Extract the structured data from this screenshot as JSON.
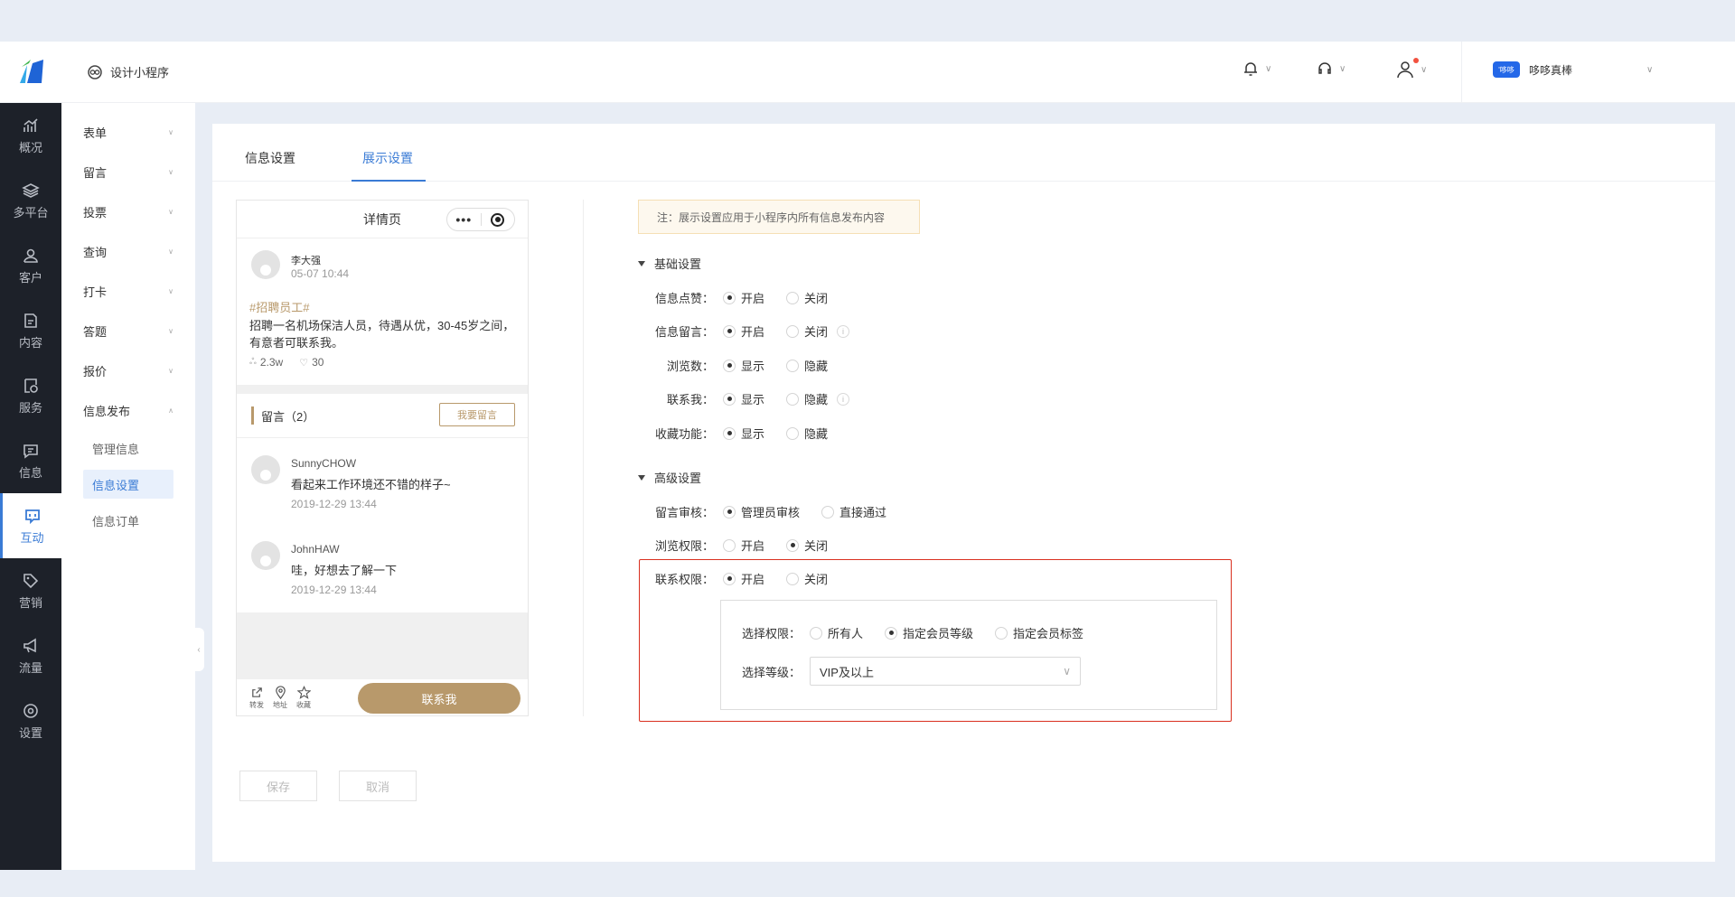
{
  "header": {
    "crumb": "设计小程序",
    "user_name": "哆哆真棒",
    "user_badge": "'哆哆"
  },
  "dark_nav": [
    {
      "label": "概况",
      "icon": "chart-icon"
    },
    {
      "label": "多平台",
      "icon": "layers-icon"
    },
    {
      "label": "客户",
      "icon": "user-icon"
    },
    {
      "label": "内容",
      "icon": "document-icon"
    },
    {
      "label": "服务",
      "icon": "service-icon"
    },
    {
      "label": "信息",
      "icon": "message-icon"
    },
    {
      "label": "互动",
      "icon": "interact-icon"
    },
    {
      "label": "营销",
      "icon": "tag-icon"
    },
    {
      "label": "流量",
      "icon": "megaphone-icon"
    },
    {
      "label": "设置",
      "icon": "settings-icon"
    }
  ],
  "sub_nav": {
    "items": [
      "表单",
      "留言",
      "投票",
      "查询",
      "打卡",
      "答题",
      "报价",
      "信息发布"
    ],
    "children": [
      "管理信息",
      "信息设置",
      "信息订单"
    ]
  },
  "tabs": [
    "信息设置",
    "展示设置"
  ],
  "phone": {
    "title": "详情页",
    "post": {
      "name": "李大强",
      "time": "05-07 10:44",
      "tag": "#招聘员工#",
      "text": "招聘一名机场保洁人员，待遇从优，30-45岁之间，有意者可联系我。",
      "views": "2.3w",
      "likes": "30"
    },
    "comments_title": "留言（2）",
    "comment_button": "我要留言",
    "comments": [
      {
        "name": "SunnyCHOW",
        "text": "看起来工作环境还不错的样子~",
        "time": "2019-12-29 13:44"
      },
      {
        "name": "JohnHAW",
        "text": "哇，好想去了解一下",
        "time": "2019-12-29 13:44"
      }
    ],
    "bar": {
      "share": "转发",
      "address": "地址",
      "favorite": "收藏",
      "contact": "联系我"
    }
  },
  "settings": {
    "note": "注：展示设置应用于小程序内所有信息发布内容",
    "basic_title": "基础设置",
    "basic": [
      {
        "label": "信息点赞：",
        "opt1": "开启",
        "opt2": "关闭"
      },
      {
        "label": "信息留言：",
        "opt1": "开启",
        "opt2": "关闭"
      },
      {
        "label": "浏览数：",
        "opt1": "显示",
        "opt2": "隐藏"
      },
      {
        "label": "联系我：",
        "opt1": "显示",
        "opt2": "隐藏"
      },
      {
        "label": "收藏功能：",
        "opt1": "显示",
        "opt2": "隐藏"
      }
    ],
    "advanced_title": "高级设置",
    "advanced": [
      {
        "label": "留言审核：",
        "opt1": "管理员审核",
        "opt2": "直接通过"
      },
      {
        "label": "浏览权限：",
        "opt1": "开启",
        "opt2": "关闭"
      },
      {
        "label": "联系权限：",
        "opt1": "开启",
        "opt2": "关闭"
      }
    ],
    "perm_label": "选择权限：",
    "perm_options": [
      "所有人",
      "指定会员等级",
      "指定会员标签"
    ],
    "level_label": "选择等级：",
    "level_value": "VIP及以上"
  },
  "buttons": {
    "save": "保存",
    "cancel": "取消"
  }
}
